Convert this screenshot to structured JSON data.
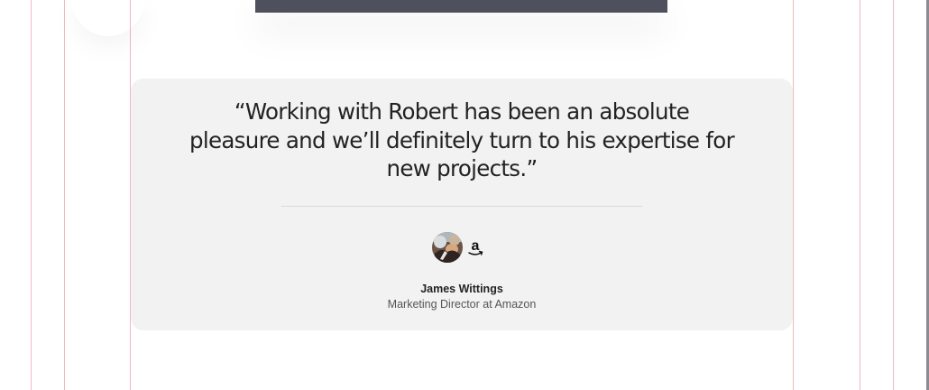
{
  "colors": {
    "guide_lines": "#f2b8c2",
    "card_background": "#f2f2f2",
    "hero_image": "#4e505d",
    "quote_text": "#222222",
    "role_text": "#555555"
  },
  "testimonial": {
    "quote": "“Working with Robert has been an absolute pleasure and we’ll definitely turn to his expertise for new projects.”",
    "author_name": "James Wittings",
    "author_role": "Marketing Director at Amazon",
    "company_logo_icon": "amazon-logo-icon",
    "avatar": "author-avatar"
  }
}
